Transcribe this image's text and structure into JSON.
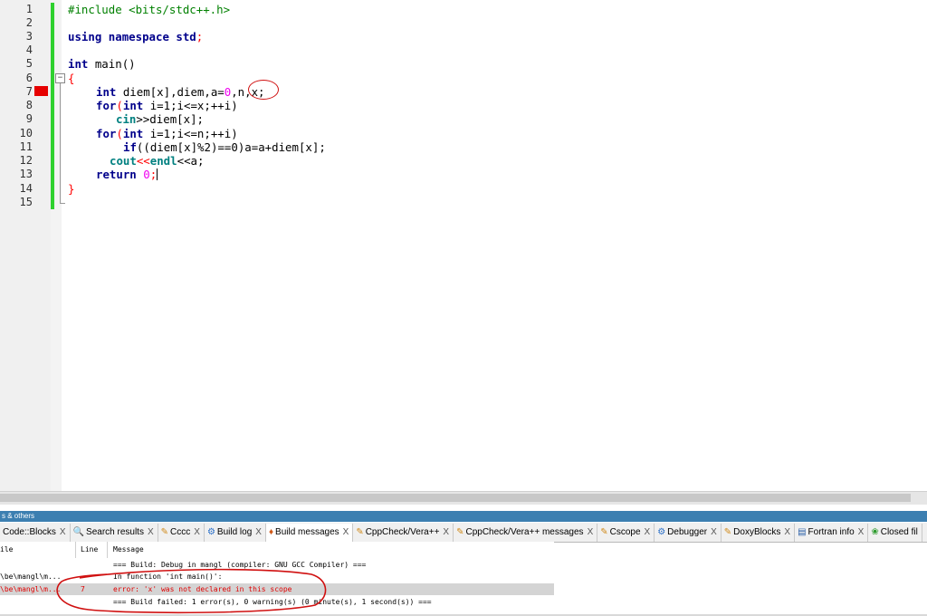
{
  "editor": {
    "line_numbers": [
      "1",
      "2",
      "3",
      "4",
      "5",
      "6",
      "7",
      "8",
      "9",
      "10",
      "11",
      "12",
      "13",
      "14",
      "15"
    ],
    "lines": {
      "l1": "#include <bits/stdc++.h>",
      "l3": {
        "k1": "using",
        "k2": "namespace",
        "k3": "std",
        ";": ";"
      },
      "l5": {
        "type": "int",
        "rest": " main()"
      },
      "l6": "{",
      "l7": {
        "type": "int",
        "rest_a": " diem[x],diem,a=",
        "zero": "0",
        "rest_b": ",n,x;"
      },
      "l8": {
        "kw": "for",
        "a": "(",
        "type": "int",
        "rest": " i=1;i<=x;++i)"
      },
      "l9": {
        "kw": "cin",
        "rest": ">>diem[x];"
      },
      "l10": {
        "kw": "for",
        "a": "(",
        "type": "int",
        "rest": " i=1;i<=n;++i)"
      },
      "l11": {
        "kw": "if",
        "rest": "((diem[x]%2)==0)a=a+diem[x];"
      },
      "l12": {
        "kw": "cout",
        "op": "<<",
        "kw2": "endl",
        "rest": "<<a;"
      },
      "l13": {
        "kw": "return",
        "sp": " ",
        "zero": "0",
        ";": ";"
      },
      "l14": "}"
    },
    "breakpoint_line": "7"
  },
  "panel": {
    "title": "s & others",
    "tabs": [
      {
        "label": "Code::Blocks",
        "icon": "codeblocks-icon"
      },
      {
        "label": "Search results",
        "icon": "search-icon"
      },
      {
        "label": "Cccc",
        "icon": "edit-icon"
      },
      {
        "label": "Build log",
        "icon": "gear-icon"
      },
      {
        "label": "Build messages",
        "icon": "pin-icon"
      },
      {
        "label": "CppCheck/Vera++",
        "icon": "edit-icon"
      },
      {
        "label": "CppCheck/Vera++ messages",
        "icon": "edit-icon"
      },
      {
        "label": "Cscope",
        "icon": "edit-icon"
      },
      {
        "label": "Debugger",
        "icon": "gear-icon"
      },
      {
        "label": "DoxyBlocks",
        "icon": "edit-icon"
      },
      {
        "label": "Fortran info",
        "icon": "document-icon"
      },
      {
        "label": "Closed fil",
        "icon": "leaf-icon"
      }
    ],
    "close_glyph": "X",
    "columns": {
      "file": "ile",
      "line": "Line",
      "message": "Message"
    },
    "rows": [
      {
        "file": "",
        "line": "",
        "message": "=== Build: Debug in mangl (compiler: GNU GCC Compiler) ==="
      },
      {
        "file": "\\be\\mangl\\m...",
        "line": "",
        "message": "In function 'int main()':"
      },
      {
        "file": "\\be\\mangl\\m...",
        "line": "7",
        "message": "error: 'x' was not declared in this scope"
      },
      {
        "file": "",
        "line": "",
        "message": "=== Build failed: 1 error(s), 0 warning(s) (0 minute(s), 1 second(s)) ==="
      }
    ]
  },
  "colors": {
    "error": "#e00000",
    "annotation": "#d01010",
    "active_line_bar": "#2fd12f",
    "panel_title": "#3c7fb1"
  }
}
